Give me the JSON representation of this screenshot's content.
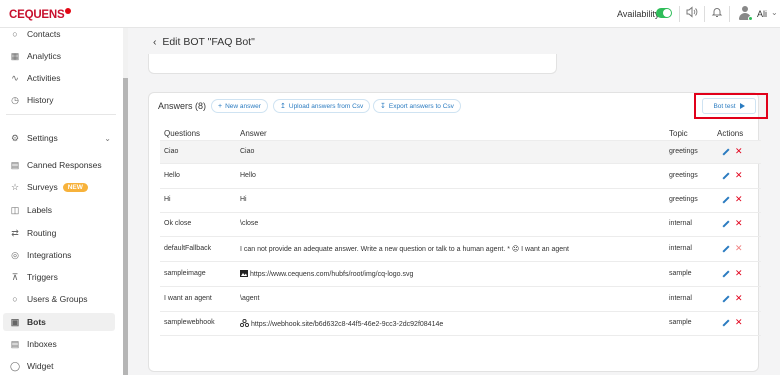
{
  "brand": {
    "logo_text": "CEQUENS",
    "accent": "#c8102e"
  },
  "topbar": {
    "availability_label": "Availability",
    "availability_on": true,
    "user_name": "Ali"
  },
  "sidebar": {
    "items": [
      {
        "label": "Contacts",
        "icon": "contacts-icon"
      },
      {
        "label": "Analytics",
        "icon": "analytics-icon"
      },
      {
        "label": "Activities",
        "icon": "activities-icon"
      },
      {
        "label": "History",
        "icon": "history-icon"
      },
      {
        "label": "Settings",
        "icon": "gear-icon"
      },
      {
        "label": "Canned Responses",
        "icon": "canned-icon"
      },
      {
        "label": "Surveys",
        "icon": "star-icon",
        "badge": "NEW"
      },
      {
        "label": "Labels",
        "icon": "tag-icon"
      },
      {
        "label": "Routing",
        "icon": "routing-icon"
      },
      {
        "label": "Integrations",
        "icon": "integrations-icon"
      },
      {
        "label": "Triggers",
        "icon": "triggers-icon"
      },
      {
        "label": "Users & Groups",
        "icon": "users-icon"
      },
      {
        "label": "Bots",
        "icon": "bot-icon",
        "active": true
      },
      {
        "label": "Inboxes",
        "icon": "inbox-icon"
      },
      {
        "label": "Widget",
        "icon": "widget-icon"
      }
    ]
  },
  "page": {
    "back_title": "Edit BOT \"FAQ Bot\""
  },
  "answers": {
    "title": "Answers (8)",
    "new_answer": "New answer",
    "upload": "Upload answers from Csv",
    "export": "Export answers to Csv",
    "bot_test": "Bot test",
    "columns": [
      "Questions",
      "Answer",
      "Topic",
      "Actions"
    ],
    "rows": [
      {
        "q": "Ciao",
        "a": "Ciao",
        "t": "greetings"
      },
      {
        "q": "Hello",
        "a": "Hello",
        "t": "greetings"
      },
      {
        "q": "Hi",
        "a": "Hi",
        "t": "greetings"
      },
      {
        "q": "Ok close",
        "a": "\\close",
        "t": "internal"
      },
      {
        "q": "defaultFallback",
        "a": "I can not provide an adequate answer. Write a new question or talk to a human agent. * ☹ I want an agent",
        "t": "internal"
      },
      {
        "q": "sampleimage",
        "a": "https://www.cequens.com/hubfs/root/img/cq-logo.svg",
        "t": "sample",
        "a_icon": "image-icon"
      },
      {
        "q": "I want an agent",
        "a": "\\agent",
        "t": "internal"
      },
      {
        "q": "samplewebhook",
        "a": "https://webhook.site/b6d632c8-44f5-46e2-9cc3-2dc92f08414e",
        "t": "sample",
        "a_icon": "webhook-icon"
      }
    ]
  }
}
